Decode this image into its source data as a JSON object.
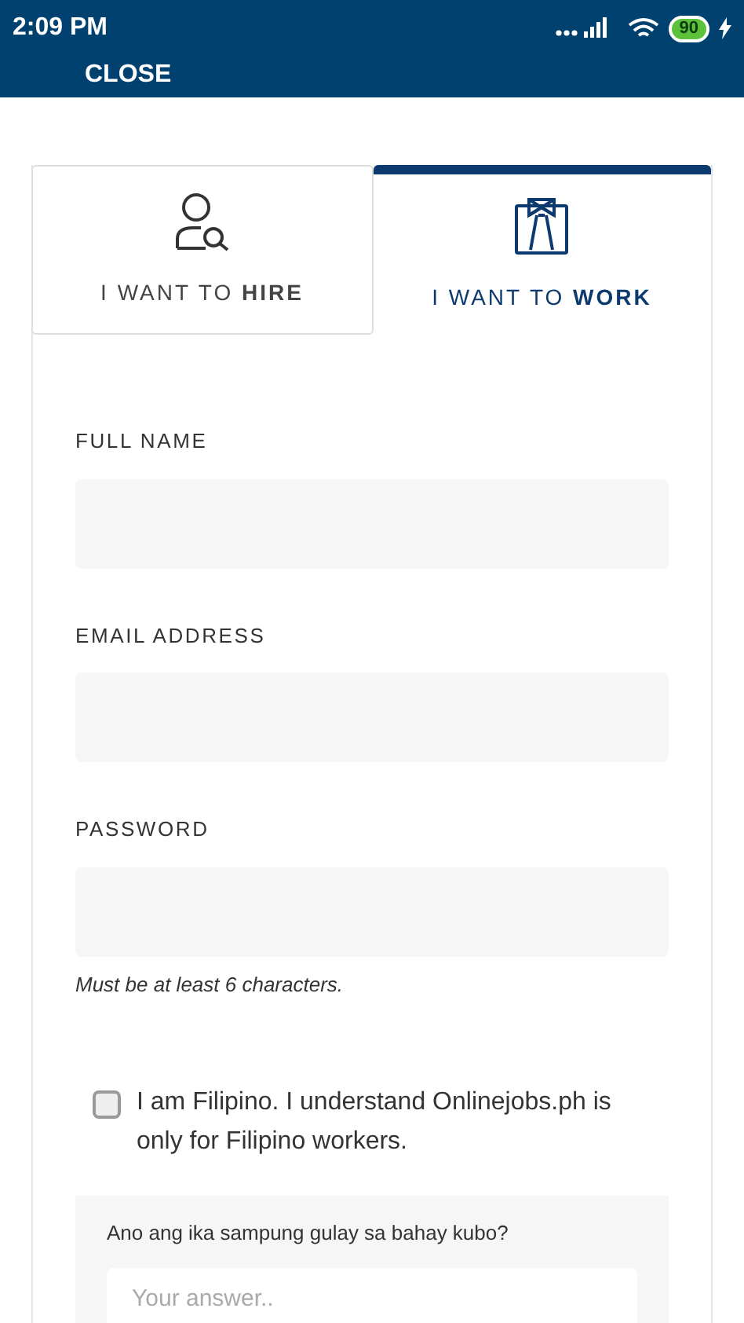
{
  "status_bar": {
    "time": "2:09 PM",
    "battery": "90"
  },
  "header": {
    "close": "CLOSE"
  },
  "tabs": [
    {
      "label": "I WANT TO **HIRE**",
      "kind": "hire",
      "selected": false
    },
    {
      "label": "I WANT TO **WORK**",
      "kind": "work",
      "selected": true
    }
  ],
  "form": {
    "fields": [
      {
        "label": "FULL NAME"
      },
      {
        "label": "EMAIL ADDRESS"
      },
      {
        "label": "PASSWORD",
        "hint": "Must be at least 6 characters."
      }
    ],
    "agreement": {
      "text": "I am Filipino. I understand Onlinejobs.ph is only for Filipino workers.",
      "checked": false
    },
    "question": {
      "prompt": "Ano ang ika sampung gulay sa bahay kubo?",
      "placeholder": "Your answer.."
    }
  }
}
